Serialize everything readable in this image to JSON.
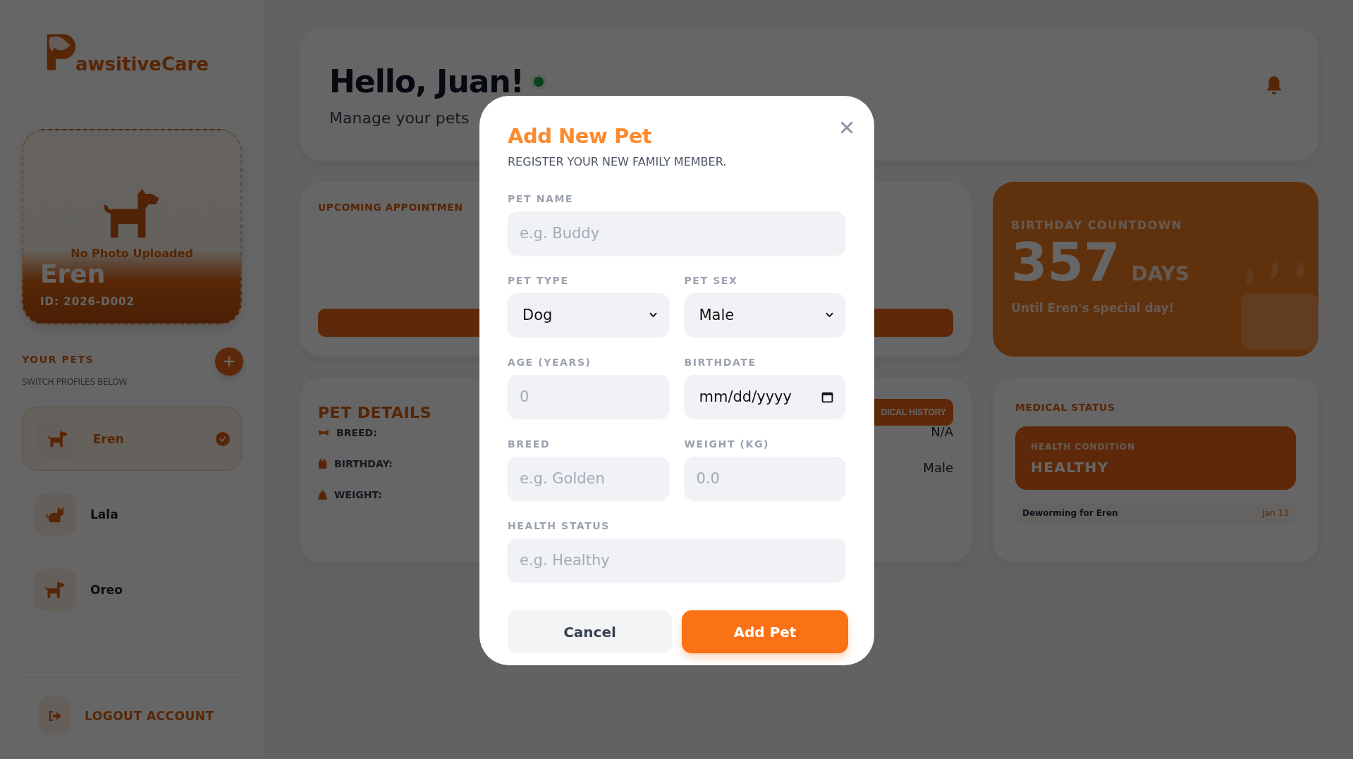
{
  "sidebar": {
    "logo_text": "awsitiveCare",
    "profile_card": {
      "photo_note": "No Photo Uploaded",
      "name": "Eren",
      "id": "ID: 2026-D002"
    },
    "pets_heading": "YOUR PETS",
    "pets_subheading": "SWITCH PROFILES BELOW",
    "pets": [
      {
        "name": "Eren",
        "kind": "dog",
        "selected": true
      },
      {
        "name": "Lala",
        "kind": "cat",
        "selected": false
      },
      {
        "name": "Oreo",
        "kind": "dog",
        "selected": false
      }
    ],
    "logout": "LOGOUT ACCOUNT"
  },
  "header": {
    "greeting": "Hello, Juan!",
    "online": true,
    "subtitle": "Manage your pets"
  },
  "appointments": {
    "title": "UPCOMING APPOINTMEN"
  },
  "birthday": {
    "title": "BIRTHDAY COUNTDOWN",
    "days": "357",
    "unit": "DAYS",
    "note": "Until Eren's special day!"
  },
  "pet_details": {
    "title": "PET DETAILS",
    "tab_button": "DICAL HISTORY",
    "rows": [
      {
        "label": "BREED:",
        "kind": "bone"
      },
      {
        "label": "BIRTHDAY:",
        "kind": "calendar"
      },
      {
        "label": "WEIGHT:",
        "kind": "weight"
      }
    ],
    "column_2": [
      "N/A",
      "Male"
    ]
  },
  "medical": {
    "title": "MEDICAL STATUS",
    "condition_label": "HEALTH CONDITION",
    "condition": "HEALTHY",
    "reminder": "Deworming for Eren",
    "reminder_date": "Jan 13"
  },
  "modal": {
    "title": "Add New Pet",
    "subtitle": "REGISTER YOUR NEW FAMILY MEMBER.",
    "fields": [
      {
        "label": "PET NAME",
        "kind": "text",
        "placeholder": "e.g. Buddy",
        "wide": true
      },
      {
        "label": "PET TYPE",
        "kind": "select",
        "value": "Dog",
        "wide": false
      },
      {
        "label": "PET SEX",
        "kind": "select",
        "value": "Male",
        "wide": false
      },
      {
        "label": "AGE (YEARS)",
        "kind": "text",
        "placeholder": "0",
        "wide": false
      },
      {
        "label": "BIRTHDATE",
        "kind": "date",
        "value": "mm/dd/yyyy",
        "wide": false
      },
      {
        "label": "BREED",
        "kind": "text",
        "placeholder": "e.g. Golden",
        "wide": false
      },
      {
        "label": "WEIGHT (KG)",
        "kind": "text",
        "placeholder": "0.0",
        "wide": false
      },
      {
        "label": "HEALTH STATUS",
        "kind": "text",
        "placeholder": "e.g. Healthy",
        "wide": true
      }
    ],
    "cancel": "Cancel",
    "submit": "Add Pet"
  }
}
